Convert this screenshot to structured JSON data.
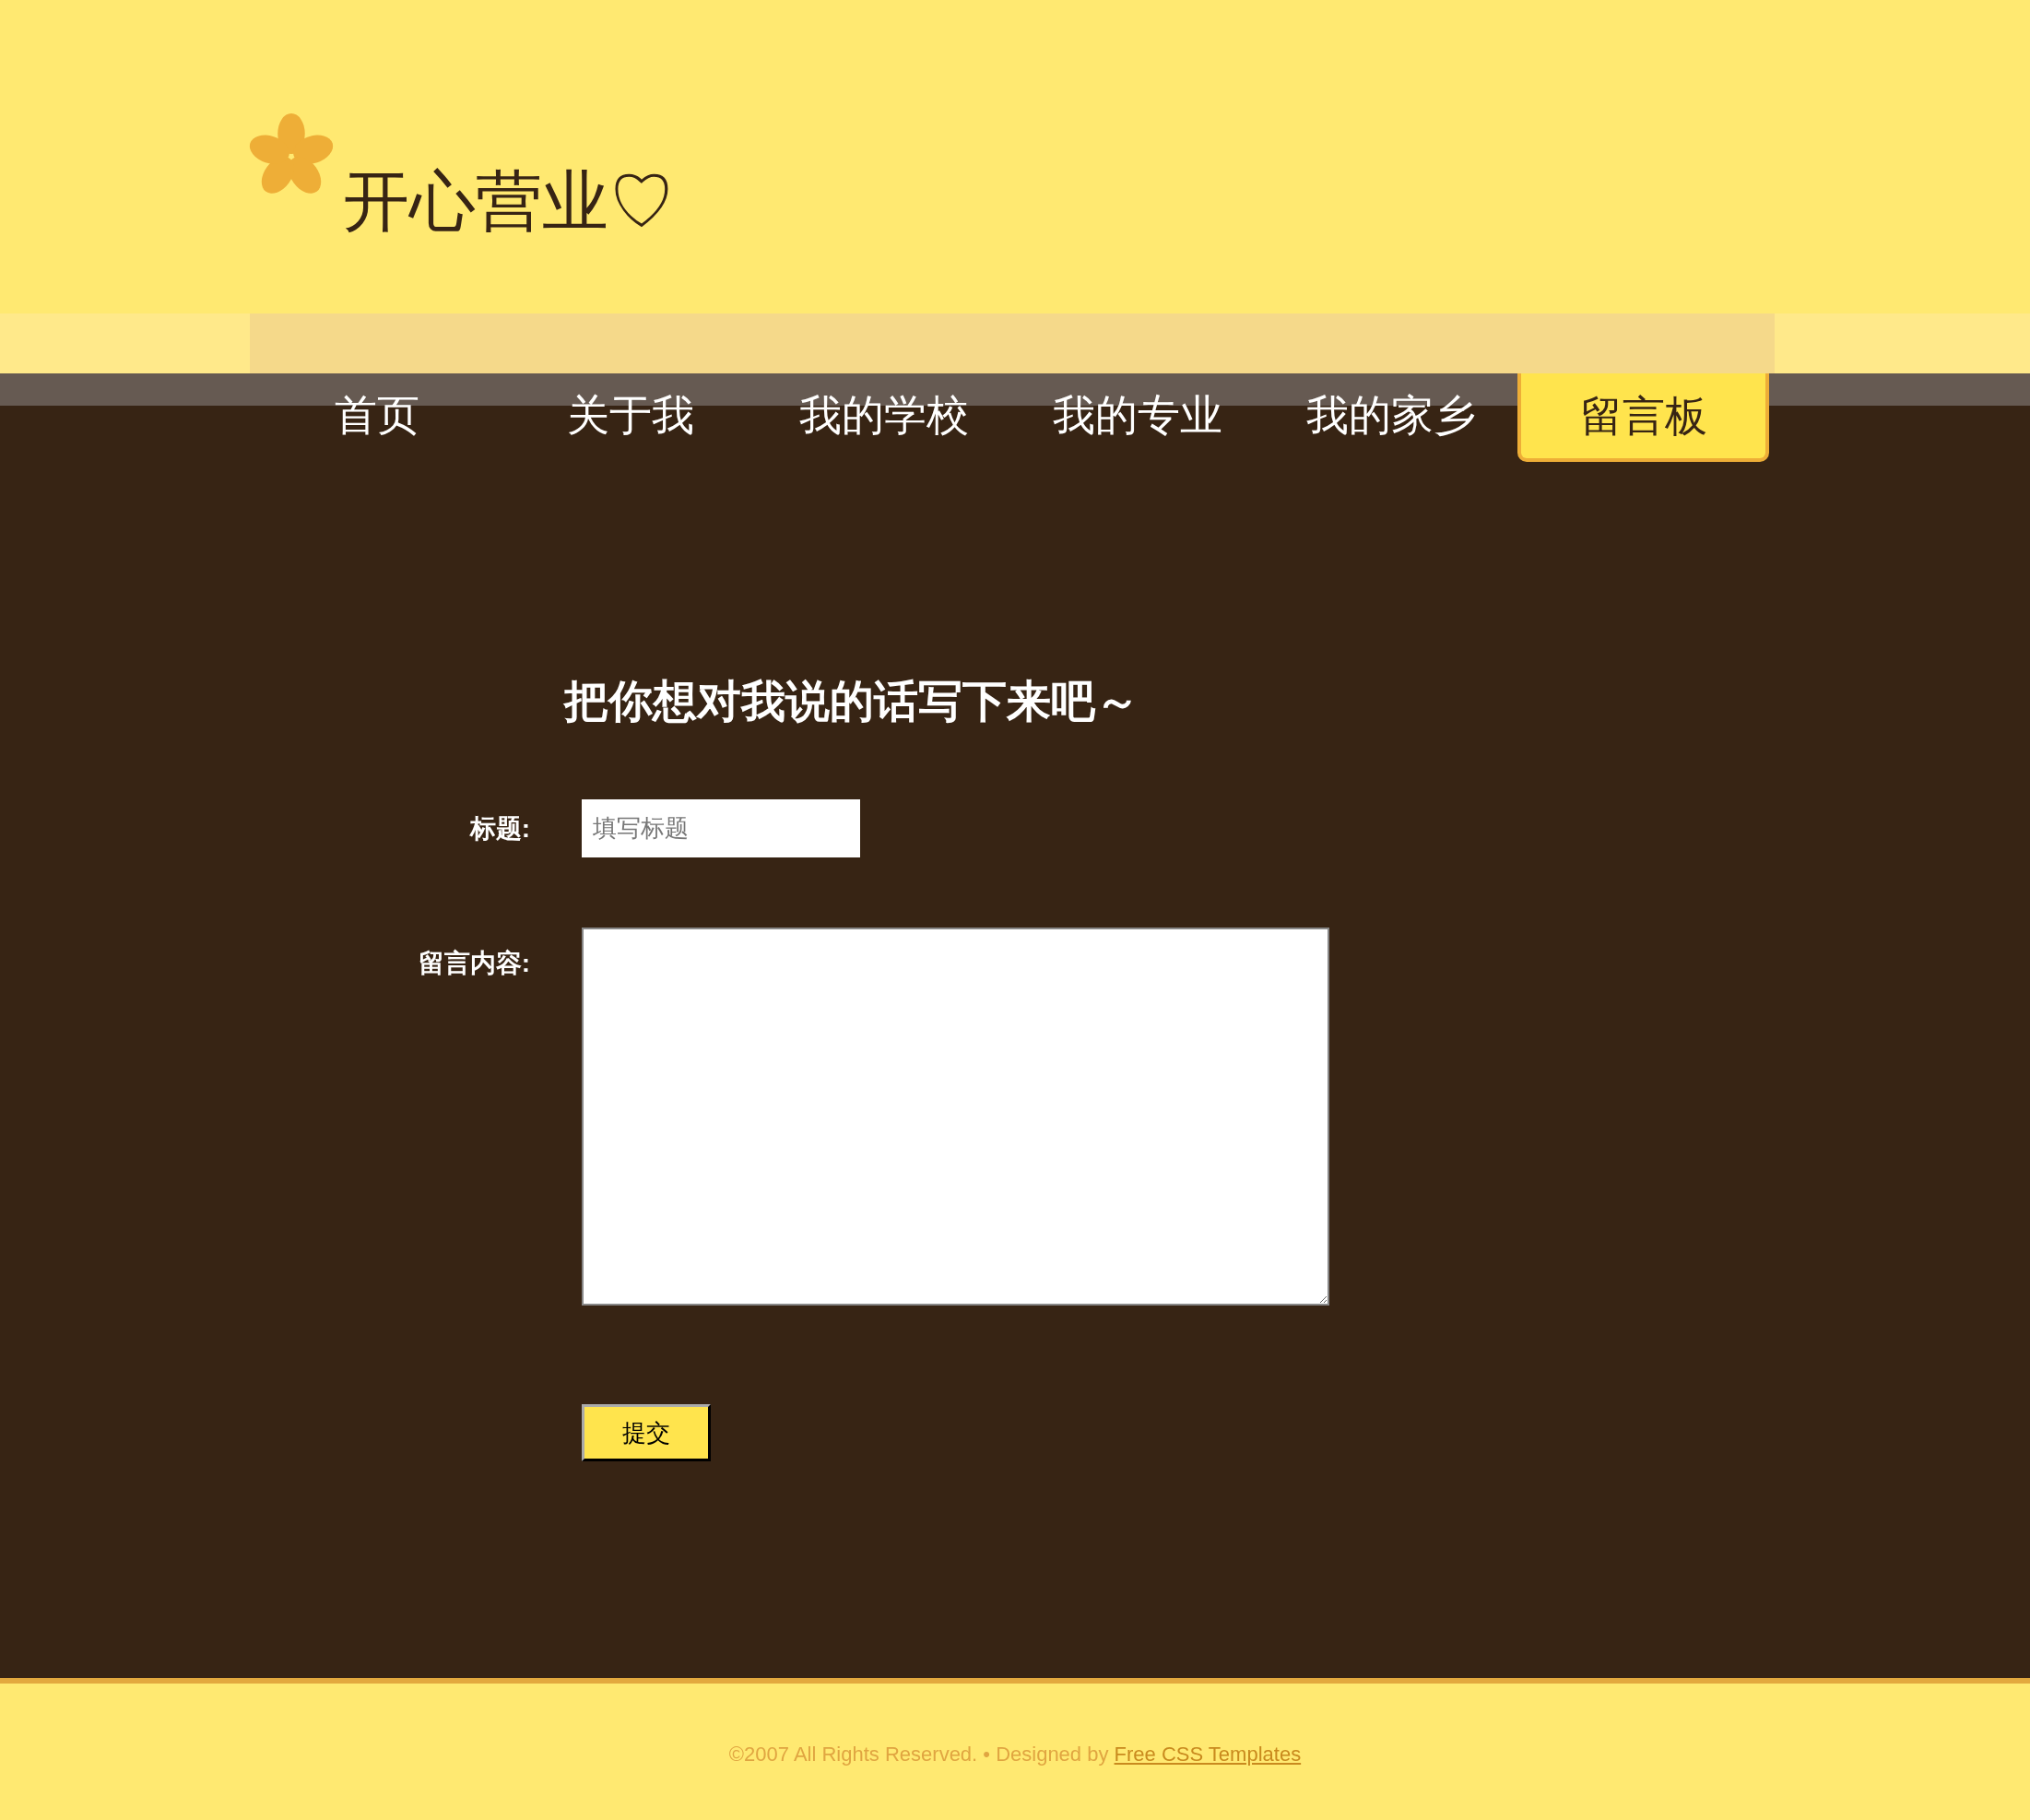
{
  "site": {
    "title": "开心营业♡"
  },
  "nav": [
    {
      "label": "首页",
      "selected": false
    },
    {
      "label": "关于我",
      "selected": false
    },
    {
      "label": "我的学校",
      "selected": false
    },
    {
      "label": "我的专业",
      "selected": false
    },
    {
      "label": "我的家乡",
      "selected": false
    },
    {
      "label": "留言板",
      "selected": true
    }
  ],
  "form": {
    "heading": "把你想对我说的话写下来吧～",
    "title_label": "标题:",
    "title_placeholder": "填写标题",
    "content_label": "留言内容:",
    "submit": "提交"
  },
  "footer": {
    "copyright": "©2007 All Rights Reserved.",
    "separator": "•",
    "designed_by": "Designed by",
    "link": "Free CSS Templates"
  }
}
